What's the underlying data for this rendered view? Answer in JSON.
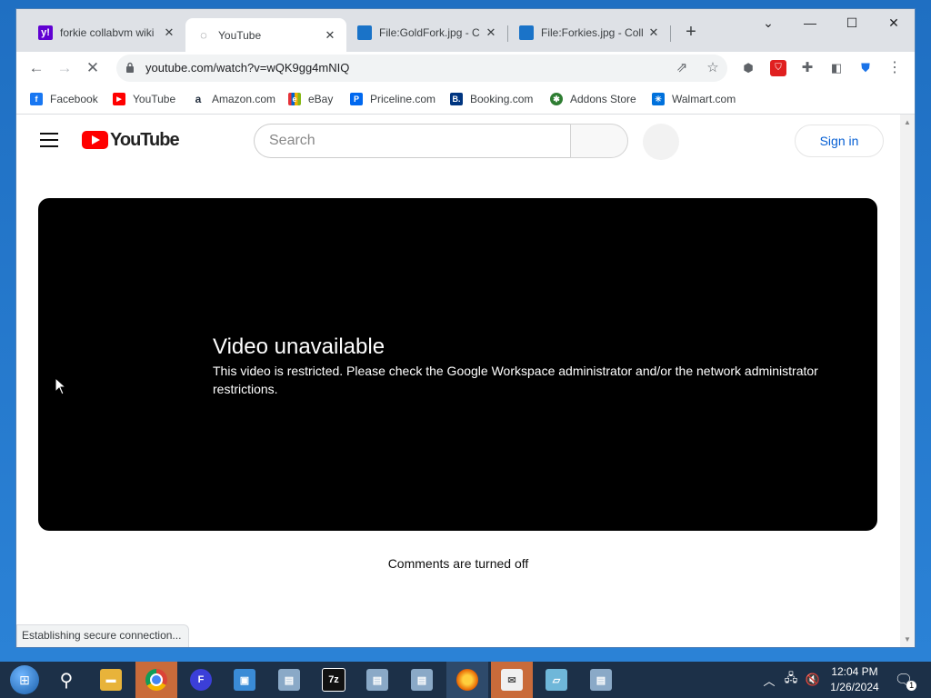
{
  "browser": {
    "tabs": [
      {
        "title": "forkie collabvm wiki",
        "favicon": "yahoo-favicon",
        "active": false
      },
      {
        "title": "YouTube",
        "favicon": "loading-spinner",
        "active": true
      },
      {
        "title": "File:GoldFork.jpg - C",
        "favicon": "monitor-favicon",
        "active": false
      },
      {
        "title": "File:Forkies.jpg - Coll",
        "favicon": "monitor-favicon",
        "active": false
      }
    ],
    "tab_close_glyph": "✕",
    "new_tab_glyph": "+",
    "window_controls": {
      "dropdown": "⌄",
      "minimize": "—",
      "maximize": "☐",
      "close": "✕"
    },
    "url": "youtube.com/watch?v=wQK9gg4mNIQ",
    "bookmarks": [
      {
        "label": "Facebook",
        "icon": "facebook-icon",
        "color": "#1877f2",
        "glyph": "f"
      },
      {
        "label": "YouTube",
        "icon": "youtube-icon",
        "color": "#ff0000",
        "glyph": "▶"
      },
      {
        "label": "Amazon.com",
        "icon": "amazon-icon",
        "color": "#232f3e",
        "glyph": "a"
      },
      {
        "label": "eBay",
        "icon": "ebay-icon",
        "color": "#e53238",
        "glyph": "e"
      },
      {
        "label": "Priceline.com",
        "icon": "priceline-icon",
        "color": "#0068ef",
        "glyph": "P"
      },
      {
        "label": "Booking.com",
        "icon": "booking-icon",
        "color": "#003580",
        "glyph": "B."
      },
      {
        "label": "Addons Store",
        "icon": "addons-icon",
        "color": "#2e7d32",
        "glyph": "✱"
      },
      {
        "label": "Walmart.com",
        "icon": "walmart-icon",
        "color": "#0071dc",
        "glyph": "✳"
      }
    ],
    "status_text": "Establishing secure connection..."
  },
  "youtube": {
    "logo_text": "YouTube",
    "search_placeholder": "Search",
    "sign_in": "Sign in",
    "error_title": "Video unavailable",
    "error_message": "This video is restricted. Please check the Google Workspace administrator and/or the network administrator restrictions.",
    "comments_text": "Comments are turned off"
  },
  "taskbar": {
    "items": [
      {
        "icon": "file-explorer-icon",
        "color": "#e8b33a",
        "glyph": "▬"
      },
      {
        "icon": "chrome-icon",
        "color": "#db4437",
        "glyph": "◉",
        "state": "highlight"
      },
      {
        "icon": "app-icon",
        "color": "#3b3fd8",
        "glyph": "F"
      },
      {
        "icon": "network-icon",
        "color": "#3a8bd6",
        "glyph": "▣"
      },
      {
        "icon": "installer-icon",
        "color": "#8aa9c7",
        "glyph": "▤"
      },
      {
        "icon": "7zip-icon",
        "color": "#111111",
        "glyph": "7z"
      },
      {
        "icon": "installer-icon-2",
        "color": "#8aa9c7",
        "glyph": "▤"
      },
      {
        "icon": "installer-icon-3",
        "color": "#8aa9c7",
        "glyph": "▤"
      },
      {
        "icon": "firefox-icon",
        "color": "#e66000",
        "glyph": "◍",
        "state": "active"
      },
      {
        "icon": "mail-icon",
        "color": "#f0f0f0",
        "glyph": "✉",
        "state": "highlight"
      },
      {
        "icon": "notepad-icon",
        "color": "#6fb7d9",
        "glyph": "▱"
      },
      {
        "icon": "installer-icon-4",
        "color": "#8aa9c7",
        "glyph": "▤"
      }
    ],
    "time": "12:04 PM",
    "date": "1/26/2024",
    "notification_count": "1"
  }
}
